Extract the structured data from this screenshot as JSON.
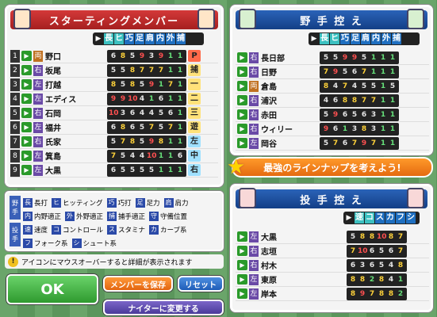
{
  "starting": {
    "title": "スターティングメンバー",
    "cols": [
      "長",
      "ヒ",
      "巧",
      "足",
      "肩",
      "内",
      "外",
      "捕"
    ],
    "rows": [
      {
        "n": "1",
        "hand": "両",
        "name": "野口",
        "s": [
          "6",
          "8",
          "5",
          "9",
          "3",
          "9",
          "1",
          "1"
        ],
        "pos": "P"
      },
      {
        "n": "2",
        "hand": "右",
        "name": "坂尾",
        "s": [
          "5",
          "5",
          "8",
          "7",
          "7",
          "7",
          "1",
          "1"
        ],
        "pos": "捕"
      },
      {
        "n": "3",
        "hand": "左",
        "name": "打越",
        "s": [
          "8",
          "5",
          "8",
          "5",
          "9",
          "1",
          "7",
          "1"
        ],
        "pos": "一"
      },
      {
        "n": "4",
        "hand": "左",
        "name": "エディス",
        "s": [
          "9",
          "9",
          "10",
          "4",
          "1",
          "6",
          "1",
          "1"
        ],
        "pos": "二"
      },
      {
        "n": "5",
        "hand": "右",
        "name": "石岡",
        "s": [
          "10",
          "3",
          "6",
          "4",
          "4",
          "5",
          "6",
          "1"
        ],
        "pos": "三"
      },
      {
        "n": "6",
        "hand": "左",
        "name": "福井",
        "s": [
          "6",
          "8",
          "6",
          "5",
          "7",
          "5",
          "7",
          "1"
        ],
        "pos": "遊"
      },
      {
        "n": "7",
        "hand": "右",
        "name": "氏家",
        "s": [
          "5",
          "7",
          "8",
          "5",
          "9",
          "8",
          "1",
          "1"
        ],
        "pos": "左"
      },
      {
        "n": "8",
        "hand": "左",
        "name": "箕島",
        "s": [
          "7",
          "5",
          "4",
          "4",
          "10",
          "1",
          "1",
          "6"
        ],
        "pos": "中"
      },
      {
        "n": "9",
        "hand": "左",
        "name": "大黒",
        "s": [
          "6",
          "5",
          "5",
          "5",
          "5",
          "1",
          "1",
          "1"
        ],
        "pos": "右"
      }
    ]
  },
  "bench": {
    "title": "野 手 控 え",
    "cols": [
      "長",
      "ヒ",
      "巧",
      "足",
      "肩",
      "内",
      "外",
      "捕"
    ],
    "rows": [
      {
        "hand": "右",
        "name": "長日部",
        "s": [
          "5",
          "5",
          "9",
          "9",
          "5",
          "1",
          "1",
          "1"
        ]
      },
      {
        "hand": "右",
        "name": "日野",
        "s": [
          "7",
          "9",
          "5",
          "6",
          "7",
          "1",
          "1",
          "1"
        ]
      },
      {
        "hand": "両",
        "name": "倉島",
        "s": [
          "8",
          "4",
          "7",
          "4",
          "5",
          "5",
          "1",
          "5"
        ]
      },
      {
        "hand": "右",
        "name": "浦沢",
        "s": [
          "4",
          "6",
          "8",
          "8",
          "7",
          "7",
          "1",
          "1"
        ]
      },
      {
        "hand": "右",
        "name": "赤田",
        "s": [
          "5",
          "9",
          "6",
          "5",
          "6",
          "3",
          "1",
          "1"
        ]
      },
      {
        "hand": "右",
        "name": "ウィリー",
        "s": [
          "9",
          "6",
          "1",
          "3",
          "8",
          "3",
          "1",
          "1"
        ]
      },
      {
        "hand": "左",
        "name": "岡谷",
        "s": [
          "5",
          "7",
          "6",
          "7",
          "9",
          "7",
          "1",
          "1"
        ]
      }
    ]
  },
  "banner": "最強のラインナップを考えよう!",
  "pitchers": {
    "title": "投 手 控 え",
    "cols": [
      "速",
      "コ",
      "ス",
      "カ",
      "フ",
      "シ"
    ],
    "rows": [
      {
        "hand": "左",
        "name": "大黒",
        "s": [
          "5",
          "8",
          "8",
          "10",
          "8",
          "7"
        ]
      },
      {
        "hand": "右",
        "name": "志垣",
        "s": [
          "7",
          "10",
          "6",
          "5",
          "6",
          "7"
        ]
      },
      {
        "hand": "右",
        "name": "村木",
        "s": [
          "6",
          "3",
          "6",
          "5",
          "4",
          "8"
        ]
      },
      {
        "hand": "左",
        "name": "東原",
        "s": [
          "8",
          "8",
          "2",
          "8",
          "4",
          "1"
        ]
      },
      {
        "hand": "左",
        "name": "岸本",
        "s": [
          "8",
          "9",
          "7",
          "8",
          "8",
          "2"
        ]
      }
    ]
  },
  "legend": {
    "fielder_tag": "野手",
    "pitcher_tag": "投手",
    "f1": [
      [
        "長",
        "長打"
      ],
      [
        "ヒ",
        "ヒッティング"
      ],
      [
        "巧",
        "巧打"
      ],
      [
        "足",
        "足力"
      ],
      [
        "肩",
        "肩力"
      ]
    ],
    "f2": [
      [
        "内",
        "内野適正"
      ],
      [
        "外",
        "外野適正"
      ],
      [
        "捕",
        "捕手適正"
      ],
      [
        "守",
        "守備位置"
      ]
    ],
    "p1": [
      [
        "速",
        "速度"
      ],
      [
        "コ",
        "コントロール"
      ],
      [
        "ス",
        "スタミナ"
      ],
      [
        "カ",
        "カーブ系"
      ]
    ],
    "p2": [
      [
        "フ",
        "フォーク系"
      ],
      [
        "シ",
        "シュート系"
      ]
    ]
  },
  "note": "アイコンにマウスオーバーすると詳細が表示されます",
  "buttons": {
    "ok": "OK",
    "save": "メンバーを保存",
    "reset": "リセット",
    "night": "ナイターに変更する"
  }
}
